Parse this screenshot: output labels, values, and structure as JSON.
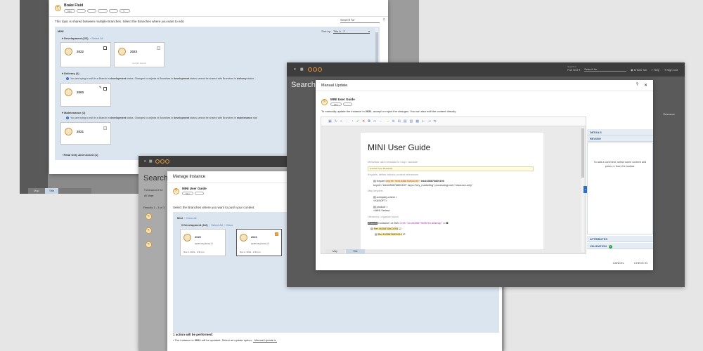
{
  "bg_app": {
    "tab_map": "Map",
    "tab_title": "Title"
  },
  "dialog_branches": {
    "topic_title": "Brake Fluid",
    "topic_pill": "Mini",
    "note": "This topic is shared between multiple Branches. Select the Branches where you want to edit.",
    "search_placeholder": "Search for",
    "group_label": "MINI",
    "sort_label": "Sort by:",
    "sort_value": "Title A - Z",
    "sections": {
      "development": {
        "label": "Development (1/2)",
        "link": "Select All"
      },
      "delivery": {
        "label": "Delivery (1)"
      },
      "maintenance": {
        "label": "Maintenance (1)"
      },
      "readonly": {
        "label": "Read Only And Closed (1)"
      }
    },
    "cards": [
      {
        "year": "2022"
      },
      {
        "year": "2023",
        "sub": "Current branch"
      },
      {
        "year": "2000"
      },
      {
        "year": "2021"
      }
    ],
    "warn_delivery": {
      "pre": "You are trying to edit in a Branch in ",
      "b1": "development",
      "mid": " status. Changes to objects in Branches in ",
      "b2": "development",
      "mid2": " status cannot be shared with Branches in ",
      "b3": "delivery",
      "end": " status."
    },
    "warn_maintenance": {
      "pre": "You are trying to edit in a Branch in ",
      "b1": "development",
      "mid": " status. Changes to objects in Branches in ",
      "b2": "development",
      "mid2": " status cannot be shared with Branches in ",
      "b3": "maintenance",
      "end": " stat"
    }
  },
  "bg_search2": {
    "heading": "Search",
    "results": "Results 1 - 3 of 3",
    "advanced": "Advanced Se",
    "filters": "All Maps"
  },
  "dialog_manage": {
    "title": "Manage Instance",
    "topic_title": "MINI User Guide",
    "topic_pill": "Mini",
    "desc": "Select the Branches where you want to push your content.",
    "group_label": "Mini",
    "clear_all": "Clear all",
    "dev_label": "Development (1/2)",
    "select_all": "Select All",
    "clear": "Clear",
    "cards": [
      {
        "year": "2020",
        "status": "(Authoring done)",
        "date": "Nov 2, 2021 - 2:31 pm"
      },
      {
        "year": "2021",
        "status": "(Authoring done)",
        "date": "Nov 2, 2021 - 2:31 pm"
      }
    ],
    "action_count": "1 action will be performed:",
    "action_pre": "The instance in ",
    "action_year": "2021",
    "action_post": " will be updated. Select an update option:",
    "update_option": "Manual Update"
  },
  "shell": {
    "heading": "Search",
    "search_scope_label": "Search In",
    "search_scope": "Full Text",
    "search_placeholder": "Search for",
    "user": "Kristin Toh",
    "help": "Help",
    "signout": "Sign Out",
    "rel": "Relevance"
  },
  "dialog_update": {
    "title": "Manual Update",
    "topic_title": "MINI User Guide",
    "topic_pill": "Mini",
    "desc_pre": "To manually update the instance in ",
    "desc_year": "2021",
    "desc_post": ", accept or reject the changes. You can also edit the content directly.",
    "doc_title": "MINI User Guide",
    "meta_label": "Metadata: add metadata to map / cascade",
    "placeholder": "(Folded Topic Metadata)",
    "keydefs_label": "Keydefs: define indirect content references",
    "keydef_a": "Keydef",
    "keydef_href": "keyref=\"teb1635876800190\"",
    "keydef_id": "teb1635876800190",
    "keydef_line2": "keyref=\"teb1635876800190\" keys=\"key_marketing\" processing-role=\"resource-only\"",
    "mapkeydefs_label": "Map keydefs",
    "company": "company-name =",
    "company_val": "<KASOFT>",
    "product": "product =",
    "product_val": "<MINI Series>",
    "hier_label": "Hierarchy: organize topics",
    "branch_tag": "Branch",
    "container": "Container of 2021",
    "container_href": "href=\"ceo1635877898716.ditamap\"",
    "ref1": "Ref:1635876800205",
    "ref2": "Ref:1635876800119",
    "tab_map": "Map",
    "tab_title": "Title",
    "details": "DETAILS",
    "review": "REVIEW",
    "review_hint": "To add a comment, select some content and press",
    "review_hint2": "from the toolbar.",
    "attributes": "ATTRIBUTES",
    "validation": "VALIDATION",
    "cancel": "CANCEL",
    "checkin": "CHECK IN"
  }
}
